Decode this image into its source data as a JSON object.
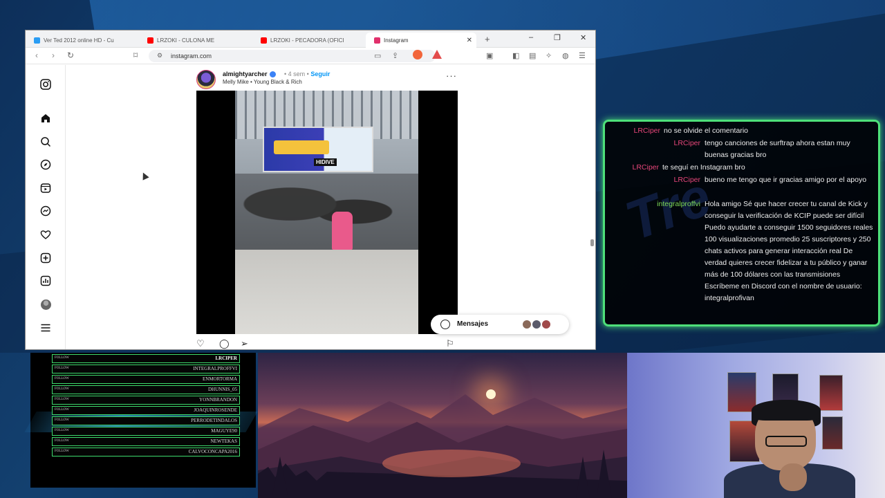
{
  "browser": {
    "tabs": [
      {
        "label": "Ver Ted 2012 online HD - Cu",
        "favicon_color": "#2a9df4"
      },
      {
        "label": "LRZOKI - CULONA ME",
        "favicon_color": "#ff0000"
      },
      {
        "label": "LRZOKI - PECADORA (OFICI",
        "favicon_color": "#ff0000"
      },
      {
        "label": "Instagram",
        "favicon_color": "#e1306c"
      }
    ],
    "new_tab": "+",
    "url": "instagram.com",
    "window_controls": [
      "–",
      "❐",
      "✕"
    ]
  },
  "instagram": {
    "sidebar_icons": [
      "instagram-logo-icon",
      "home-icon",
      "search-icon",
      "explore-icon",
      "reels-icon",
      "messenger-icon",
      "heart-icon",
      "create-icon",
      "dashboard-icon",
      "profile-avatar",
      "menu-icon"
    ],
    "post": {
      "username": "almightyarcher",
      "time": "4 sem",
      "follow": "Seguir",
      "song": "Melly Mike • Young Black & Rich",
      "banner_text": "HIDIVE"
    },
    "messages": {
      "label": "Mensajes"
    }
  },
  "chat": {
    "messages": [
      {
        "name": "LRCiper",
        "name_color": "#e8467a",
        "text": "no se olvide el comentario"
      },
      {
        "name": "LRCiper",
        "name_color": "#e8467a",
        "text": "tengo canciones de surftrap ahora estan muy buenas gracias bro"
      },
      {
        "name": "LRCiper",
        "name_color": "#e8467a",
        "text": "te seguí en Instagram bro"
      },
      {
        "name": "LRCiper",
        "name_color": "#e8467a",
        "text": "bueno me tengo que ir gracias amigo por el apoyo"
      },
      {
        "name": "integralproffvi",
        "name_color": "#7ed957",
        "text": "Hola amigo Sé que hacer crecer tu canal de Kick y conseguir la verificación de KCIP puede ser difícil Puedo ayudarte a conseguir 1500 seguidores reales 100 visualizaciones promedio 25 suscriptores y 250 chats activos para generar interacción real De verdad quieres crecer fidelizar a tu público y ganar más de 100 dólares con las transmisiones Escríbeme en Discord con el nombre de usuario: integralprofivan"
      }
    ]
  },
  "follows": {
    "tag": "FOLLOW",
    "names": [
      "LRCIPER",
      "INTEGRALPROFFVI",
      "ENMORTORMA",
      "DHUNNIS_05",
      "YONNBRANDON",
      "JOAQUINROSENDE",
      "PERRODETINDALOS",
      "MAGUYE90",
      "NEWTEKAS",
      "CALVOCONCAPA2016"
    ]
  },
  "colors": {
    "accent_green": "#4ee07a",
    "ig_blue": "#0095f6",
    "chat_name_pink": "#e8467a",
    "chat_name_green": "#7ed957"
  }
}
